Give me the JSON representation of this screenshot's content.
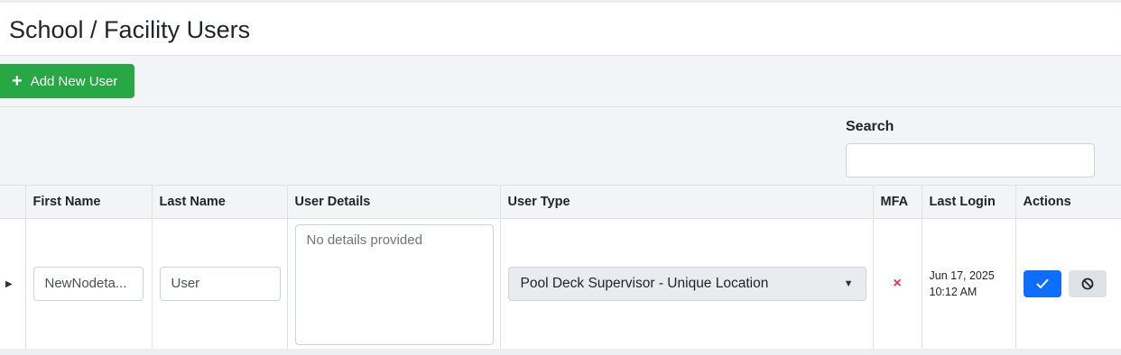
{
  "page": {
    "title": "School / Facility Users"
  },
  "toolbar": {
    "add_label": "Add New User",
    "add_icon": "plus-icon",
    "add_color": "#28a745"
  },
  "search": {
    "label": "Search",
    "value": ""
  },
  "table": {
    "columns": [
      "First Name",
      "Last Name",
      "User Details",
      "User Type",
      "MFA",
      "Last Login",
      "Actions"
    ],
    "rows": [
      {
        "first_name": "NewNodeta...",
        "last_name": "User",
        "details": "No details provided",
        "user_type": "Pool Deck Supervisor - Unique Location",
        "mfa": "×",
        "last_login_date": "Jun 17, 2025",
        "last_login_time": "10:12 AM",
        "actions": [
          "approve-check-icon",
          "disable-ban-icon"
        ]
      }
    ]
  },
  "colors": {
    "primary": "#0d6efd",
    "danger": "#dc3545",
    "success": "#28a745"
  }
}
